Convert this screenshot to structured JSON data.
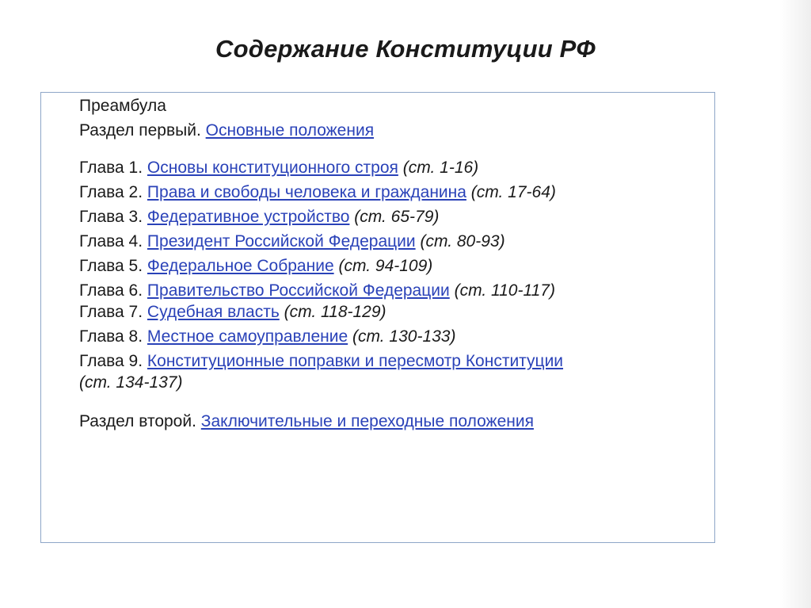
{
  "title": "Содержание Конституции РФ",
  "colors": {
    "link": "#2a42b8",
    "box_border": "#8ea6c8",
    "text": "#1a1a1a"
  },
  "preamble": "Преамбула",
  "section1": {
    "prefix": "Раздел первый.",
    "link": "Основные положения"
  },
  "chapters": [
    {
      "prefix": "Глава 1.",
      "link": "Основы конституционного строя",
      "articles": "(ст. 1-16)"
    },
    {
      "prefix": "Глава 2.",
      "link": "Права и свободы человека и гражданина",
      "articles": "(ст. 17-64)"
    },
    {
      "prefix": "Глава 3.",
      "link": "Федеративное устройство",
      "articles": "(ст. 65-79)"
    },
    {
      "prefix": "Глава 4.",
      "link": "Президент Российской Федерации",
      "articles": "(ст. 80-93)"
    },
    {
      "prefix": "Глава 5.",
      "link": "Федеральное Собрание",
      "articles": "(ст. 94-109)"
    },
    {
      "prefix": "Глава 6.",
      "link": "Правительство Российской Федерации",
      "articles": "(ст. 110-117)"
    },
    {
      "prefix": "Глава 7.",
      "link": "Судебная власть",
      "articles": "(ст. 118-129)"
    },
    {
      "prefix": "Глава 8.",
      "link": "Местное самоуправление",
      "articles": "(ст. 130-133)"
    },
    {
      "prefix": "Глава 9.",
      "link": "Конституционные поправки и пересмотр Конституции",
      "articles": "(ст. 134-137)"
    }
  ],
  "section2": {
    "prefix": "Раздел второй.",
    "link": "Заключительные и переходные положения"
  }
}
